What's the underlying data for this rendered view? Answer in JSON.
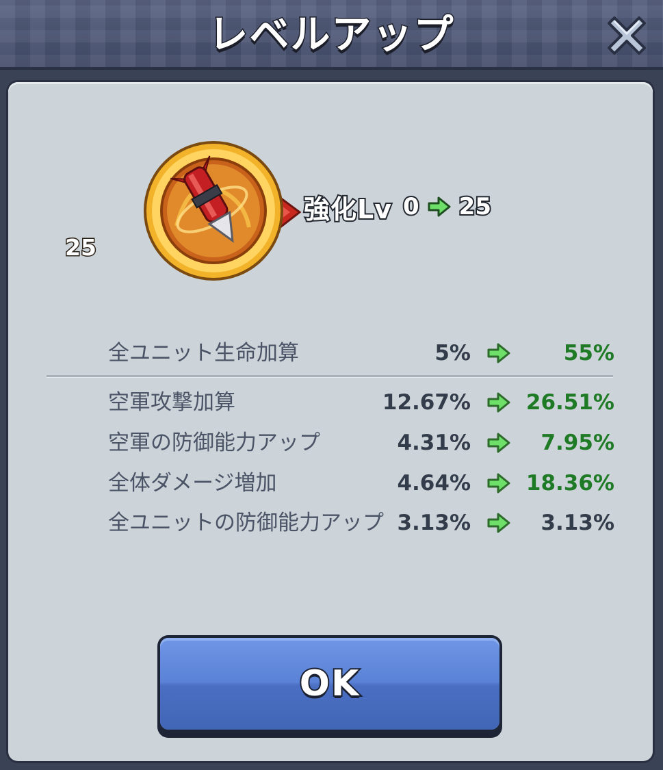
{
  "header": {
    "title": "レベルアップ"
  },
  "medal": {
    "level": "25"
  },
  "enhance": {
    "label": "強化Lv",
    "from": "0",
    "to": "25"
  },
  "stats": [
    {
      "name": "全ユニット生命加算",
      "before": "5%",
      "after": "55%",
      "changed": true
    },
    {
      "name": "空軍攻撃加算",
      "before": "12.67%",
      "after": "26.51%",
      "changed": true
    },
    {
      "name": "空軍の防御能力アップ",
      "before": "4.31%",
      "after": "7.95%",
      "changed": true
    },
    {
      "name": "全体ダメージ増加",
      "before": "4.64%",
      "after": "18.36%",
      "changed": true
    },
    {
      "name": "全ユニットの防御能力アップ",
      "before": "3.13%",
      "after": "3.13%",
      "changed": false
    }
  ],
  "ok_button": {
    "label": "OK"
  },
  "colors": {
    "increase": "#1f7a26",
    "arrow": "#6ee06a",
    "button": "#5a82d6",
    "medal_gold": "#f2b32a"
  }
}
